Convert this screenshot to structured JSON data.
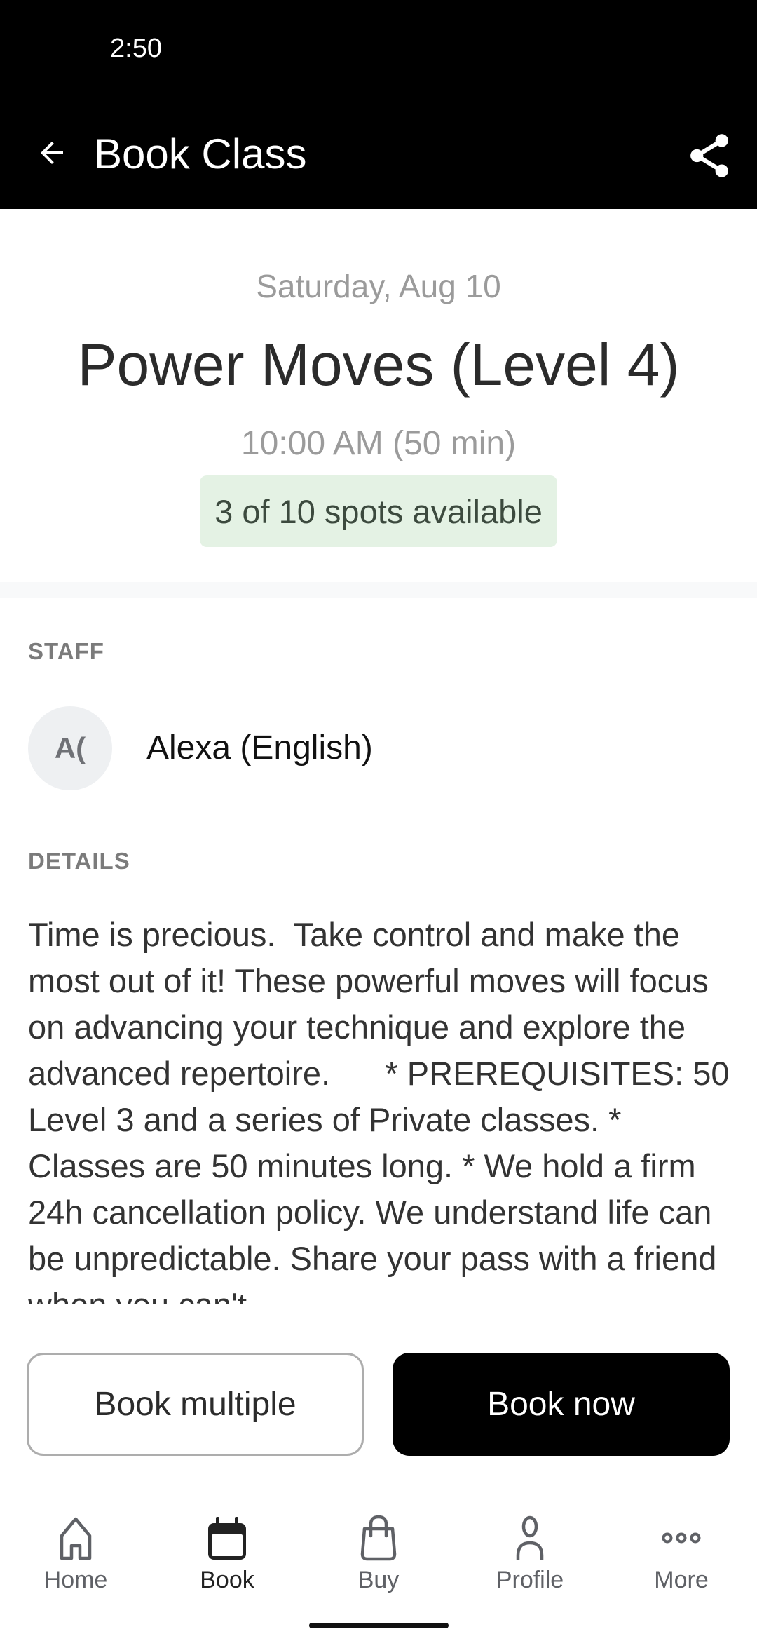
{
  "status_bar": {
    "time": "2:50"
  },
  "app_bar": {
    "title": "Book Class",
    "back_icon": "arrow-left-icon",
    "share_icon": "share-icon"
  },
  "class_info": {
    "date": "Saturday, Aug 10",
    "title": "Power Moves (Level 4)",
    "time": "10:00 AM (50 min)",
    "availability": "3 of 10 spots available",
    "spots_open": 3,
    "spots_total": 10
  },
  "staff": {
    "label": "STAFF",
    "members": [
      {
        "initials": "A(",
        "name": "Alexa (English)"
      }
    ]
  },
  "details": {
    "label": "DETAILS",
    "text": "Time is precious.  Take control and make the most out of it! These powerful moves will focus on advancing your technique and explore the advanced repertoire.      * PREREQUISITES: 50 Level 3 and a series of Private classes. * Classes are 50 minutes long. * We hold a firm 24h cancellation policy. We understand life can be unpredictable. Share your pass with a friend when you can't"
  },
  "actions": {
    "book_multiple": "Book multiple",
    "book_now": "Book now"
  },
  "bottom_nav": {
    "items": [
      {
        "label": "Home",
        "icon": "home-icon",
        "active": false
      },
      {
        "label": "Book",
        "icon": "calendar-icon",
        "active": true
      },
      {
        "label": "Buy",
        "icon": "shopping-bag-icon",
        "active": false
      },
      {
        "label": "Profile",
        "icon": "person-icon",
        "active": false
      },
      {
        "label": "More",
        "icon": "more-dots-icon",
        "active": false
      }
    ]
  },
  "colors": {
    "header_bg": "#000000",
    "badge_bg": "#e4f2e4",
    "badge_text": "#3c4a3e",
    "primary_button": "#000000",
    "muted_text": "#9b9b9b"
  }
}
